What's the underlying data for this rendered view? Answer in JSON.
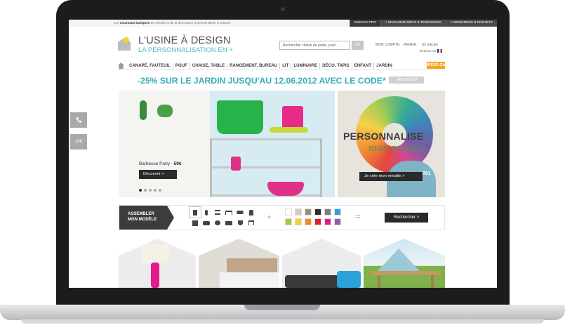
{
  "topbar": {
    "tagline_prefix": "Les",
    "tagline_bold": "nouveaux basiques",
    "tagline_rest": "du meuble et de la décoration à personnaliser à volonté.",
    "links": [
      "ESPACE PRO",
      "> MAGAZINE DÉCO & TENDANCES",
      "> DESIGNERS & PROJETS"
    ]
  },
  "header": {
    "logo_line1": "L'USINE À DESIGN",
    "logo_line2": "LA PERSONNALISATION EN +",
    "search_placeholder": "Rechercher chaise de jardin, pouf...",
    "search_button": "OK",
    "account": "MON COMPTE",
    "cart": "PANIER :",
    "cart_count": "33 articles",
    "delivery": "livraison en"
  },
  "nav": {
    "items": [
      "CANAPÉ, FAUTEUIL",
      "POUF",
      "CHAISE, TABLE",
      "RANGEMENT, BUREAU",
      "LIT",
      "LUMINAIRE",
      "DÉCO, TAPIS",
      "ENFANT",
      "JARDIN"
    ],
    "cta": "IDÉES CADEAU"
  },
  "promo": {
    "text": "-25% SUR LE JARDIN JUSQU'AU 12.06.2012 AVEC LE CODE*",
    "code": "JARDINJUN"
  },
  "hero": {
    "caption_label": "Barbecue Party -",
    "caption_price": "59€",
    "button": "Découvrir  >",
    "slide_count": 5,
    "active_slide": 0
  },
  "side_promo": {
    "title1": "PERSONNALISE",
    "title2": "mon meuble",
    "button": "Je crée mon meuble  >",
    "number": "001"
  },
  "configurator": {
    "label_line1": "ASSEMBLER",
    "label_line2": "MON MODÈLE",
    "plus": "+",
    "equals": "=",
    "button": "Rechercher  >",
    "swatch_colors": [
      "#ffffff",
      "#d8c9b4",
      "#9a8c80",
      "#2a2a2a",
      "#7d7d7d",
      "#2aa3dc",
      "#9ccf3a",
      "#f5d22b",
      "#f08a24",
      "#e21b2c",
      "#e21b8c",
      "#8e5fb0"
    ]
  },
  "side_tabs": {
    "phone_icon": "phone-icon",
    "euro": "10€"
  },
  "colors": {
    "accent_teal": "#35aeb5",
    "accent_orange": "#f2a81d",
    "accent_pink": "#e21b8c"
  }
}
